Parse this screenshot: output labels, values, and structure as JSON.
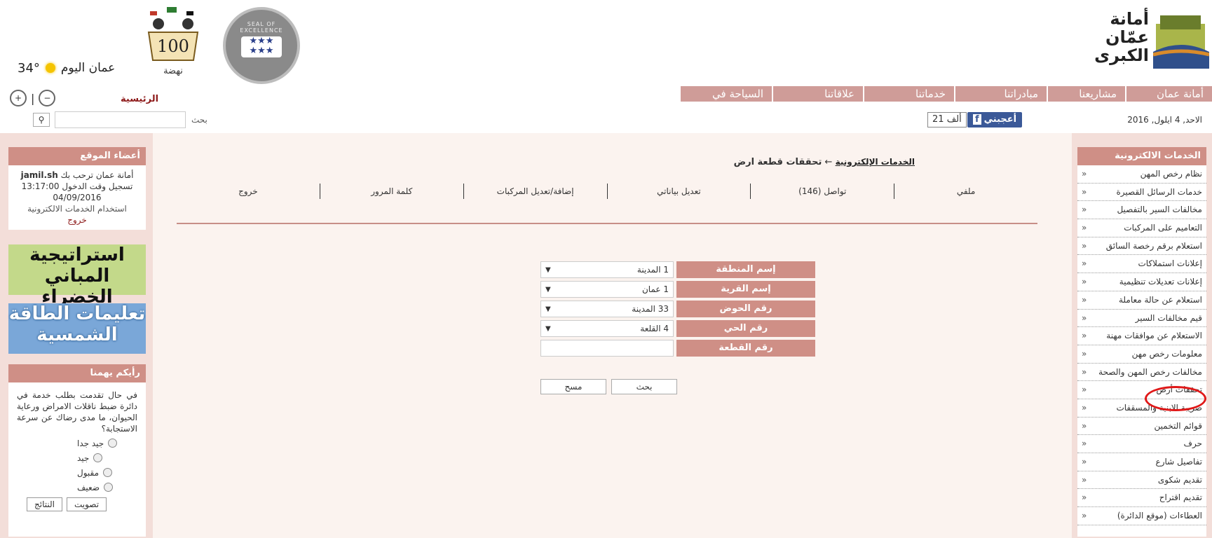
{
  "header": {
    "logo_line1": "أمانة",
    "logo_line2": "عمّان",
    "logo_line3": "الكبرى",
    "seal_text": "SEAL OF EXCELLENCE",
    "emblem_text": "100",
    "emblem_caption": "نهضة",
    "weather_label": "عمان اليوم",
    "temperature": "34°"
  },
  "nav": {
    "tabs": [
      "أمانة عمان",
      "مشاريعنا",
      "مبادراتنا",
      "خدماتنا",
      "علاقاتنا",
      "السياحة في عمان"
    ],
    "home_label": "الرئيسية"
  },
  "toolbar": {
    "search_label": "بحث",
    "search_value": "",
    "fb_like_label": "أعجبني",
    "fb_count": "21 ألف",
    "date": "الاحد, 4 ايلول, 2016"
  },
  "right_sidebar": {
    "title": "الخدمات الالكترونية",
    "items": [
      "نظام رخص المهن",
      "خدمات الرسائل القصيرة",
      "مخالفات السير بالتفصيل",
      "التعاميم على المركبات",
      "استعلام برقم رخصة السائق",
      "إعلانات استملاكات",
      "إعلانات تعديلات تنظيمية",
      "استعلام عن حالة معاملة",
      "قيم مخالفات السير",
      "الاستعلام عن موافقات مهنة",
      "معلومات رخص مهن",
      "مخالفات رخص المهن والصحة",
      "تحققات أرض",
      "ضريبة الابنية والمسقفات",
      "قوائم التخمين",
      "حرف",
      "تفاصيل شارع",
      "تقديم شكوى",
      "تقديم اقتراح",
      "العطاءات (موقع الدائرة)"
    ]
  },
  "left_sidebar": {
    "members_title": "أعضاء الموقع",
    "welcome_prefix": "أمانة عمان ترحب بك",
    "username": "jamil.sh",
    "login_time": "تسجيل وقت الدخول 13:17:00",
    "login_date": "04/09/2016",
    "usage_text": "استخدام الخدمات الالكترونية",
    "logout": "خروج",
    "banner1": "استراتيجية المباني الخضراء",
    "banner2": "تعليمات الطاقة الشمسية",
    "poll_title": "رأيكم يهمنا",
    "poll_question": "في حال تقدمت بطلب خدمة في دائرة ضبط ناقلات الامراض ورعاية الحيوان، ما مدى رضاك عن سرعة الاستجابة؟",
    "poll_options": [
      "جيد جدا",
      "جيد",
      "مقبول",
      "ضعيف"
    ],
    "vote_btn": "تصويت",
    "results_btn": "النتائج"
  },
  "content": {
    "breadcrumb_link": "الخدمات الإلكترونية",
    "breadcrumb_arrow": "←",
    "breadcrumb_current": "تحققات قطعة ارض",
    "menu": [
      "ملفي",
      "تواصل (146)",
      "تعديل بياناتي",
      "إضافة/تعديل المركبات",
      "كلمة المرور",
      "خروج"
    ],
    "form": {
      "region_label": "إسم المنطقة",
      "region_value": "1 المدينة",
      "village_label": "إسم القرية",
      "village_value": "1 عمان",
      "basin_label": "رقم الحوض",
      "basin_value": "33 المدينة",
      "district_label": "رقم الحي",
      "district_value": "4 القلعة",
      "plot_label": "رقم القطعة",
      "plot_value": "",
      "search_btn": "بحث",
      "clear_btn": "مسح"
    }
  },
  "colors": {
    "accent": "#cf8f86",
    "nav_tab": "#cf9c98",
    "sidebar_bg": "#f3ded9",
    "highlight_circle": "#e01818",
    "facebook": "#3b5998"
  }
}
